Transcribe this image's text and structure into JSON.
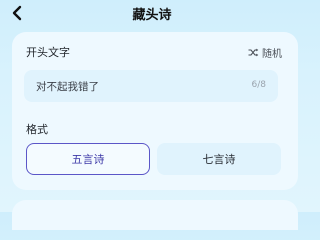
{
  "header": {
    "title": "藏头诗",
    "back_icon": "chevron-left-icon"
  },
  "opening": {
    "label": "开头文字",
    "random_label": "随机",
    "random_icon": "shuffle-icon",
    "input_value": "对不起我错了",
    "counter": "6/8"
  },
  "format": {
    "label": "格式",
    "options": [
      "五言诗",
      "七言诗"
    ],
    "selected": "五言诗"
  },
  "colors": {
    "accent": "#5b56c8",
    "background": "#d8f2fd"
  }
}
